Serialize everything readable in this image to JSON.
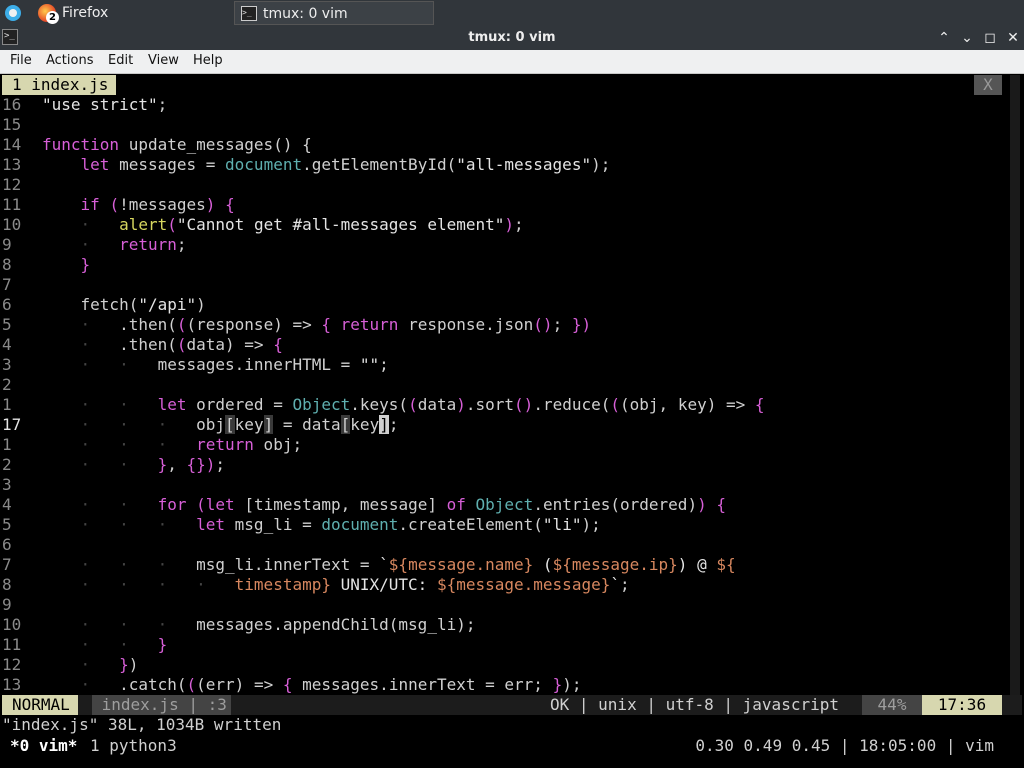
{
  "taskbar": {
    "tasks": [
      {
        "label": "Firefox",
        "badge": "2"
      },
      {
        "label": "tmux: 0 vim"
      }
    ]
  },
  "window": {
    "title": "tmux: 0 vim",
    "app_icon_glyph": ">_",
    "buttons": {
      "minimize": "⌃",
      "restore": "⌄",
      "maximize": "◻",
      "close": "✕"
    }
  },
  "menubar": [
    "File",
    "Actions",
    "Edit",
    "View",
    "Help"
  ],
  "vim": {
    "tab": {
      "number": "1",
      "name": "index.js",
      "close": "X"
    },
    "lines": [
      {
        "n": "16",
        "parts": [
          [
            "str",
            "\"use strict\""
          ],
          [
            "",
            ";"
          ]
        ]
      },
      {
        "n": "15",
        "parts": []
      },
      {
        "n": "14",
        "parts": [
          [
            "kw",
            "function"
          ],
          [
            "",
            " update_messages() {"
          ]
        ]
      },
      {
        "n": "13",
        "parts": [
          [
            "",
            "    "
          ],
          [
            "kw",
            "let"
          ],
          [
            "",
            " messages = "
          ],
          [
            "obj",
            "document"
          ],
          [
            "",
            ".getElementById("
          ],
          [
            "str",
            "\"all-messages\""
          ],
          [
            "",
            ");"
          ]
        ]
      },
      {
        "n": "12",
        "parts": []
      },
      {
        "n": "11",
        "parts": [
          [
            "",
            "    "
          ],
          [
            "kw",
            "if"
          ],
          [
            "",
            " "
          ],
          [
            "paren",
            "("
          ],
          [
            "",
            "!messages"
          ],
          [
            "paren",
            ")"
          ],
          [
            "",
            " "
          ],
          [
            "paren",
            "{"
          ]
        ]
      },
      {
        "n": "10",
        "parts": [
          [
            "dot",
            "    ·   "
          ],
          [
            "fn",
            "alert"
          ],
          [
            "paren",
            "("
          ],
          [
            "str",
            "\"Cannot get #all-messages element\""
          ],
          [
            "paren",
            ")"
          ],
          [
            "",
            ";"
          ]
        ]
      },
      {
        "n": "9",
        "parts": [
          [
            "dot",
            "    ·   "
          ],
          [
            "kw",
            "return"
          ],
          [
            "",
            ";"
          ]
        ]
      },
      {
        "n": "8",
        "parts": [
          [
            "",
            "    "
          ],
          [
            "paren",
            "}"
          ]
        ]
      },
      {
        "n": "7",
        "parts": []
      },
      {
        "n": "6",
        "parts": [
          [
            "",
            "    fetch("
          ],
          [
            "str",
            "\"/api\""
          ],
          [
            "",
            ")"
          ]
        ]
      },
      {
        "n": "5",
        "parts": [
          [
            "dot",
            "    ·   "
          ],
          [
            "",
            ".then("
          ],
          [
            "paren",
            "("
          ],
          [
            "",
            "(response) => "
          ],
          [
            "paren",
            "{"
          ],
          [
            "",
            " "
          ],
          [
            "kw",
            "return"
          ],
          [
            "",
            " response.json"
          ],
          [
            "paren",
            "()"
          ],
          [
            "",
            "; "
          ],
          [
            "paren",
            "}"
          ],
          [
            "paren",
            ")"
          ]
        ]
      },
      {
        "n": "4",
        "parts": [
          [
            "dot",
            "    ·   "
          ],
          [
            "",
            ".then("
          ],
          [
            "paren",
            "("
          ],
          [
            "",
            "data) => "
          ],
          [
            "paren",
            "{"
          ]
        ]
      },
      {
        "n": "3",
        "parts": [
          [
            "dot",
            "    ·   ·   "
          ],
          [
            "",
            "messages.innerHTML = "
          ],
          [
            "str",
            "\"\""
          ],
          [
            "",
            ";"
          ]
        ]
      },
      {
        "n": "2",
        "parts": []
      },
      {
        "n": "1",
        "parts": [
          [
            "dot",
            "    ·   ·   "
          ],
          [
            "kw",
            "let"
          ],
          [
            "",
            " ordered = "
          ],
          [
            "obj",
            "Object"
          ],
          [
            "",
            ".keys("
          ],
          [
            "paren",
            "("
          ],
          [
            "",
            "data"
          ],
          [
            "paren",
            ")"
          ],
          [
            "",
            ".sort"
          ],
          [
            "paren",
            "()"
          ],
          [
            "",
            ".reduce("
          ],
          [
            "paren",
            "("
          ],
          [
            "",
            "(obj, key) => "
          ],
          [
            "paren",
            "{"
          ]
        ]
      },
      {
        "n": "17",
        "current": true,
        "parts": [
          [
            "dot",
            "    ·   ·   ·   "
          ],
          [
            "",
            "obj"
          ],
          [
            "match",
            "["
          ],
          [
            "",
            "key"
          ],
          [
            "match",
            "]"
          ],
          [
            "",
            " = data"
          ],
          [
            "match",
            "["
          ],
          [
            "",
            "key"
          ],
          [
            "cursor",
            "]"
          ],
          [
            "",
            ";"
          ]
        ]
      },
      {
        "n": "1",
        "parts": [
          [
            "dot",
            "    ·   ·   ·   "
          ],
          [
            "kw",
            "return"
          ],
          [
            "",
            " obj;"
          ]
        ]
      },
      {
        "n": "2",
        "parts": [
          [
            "dot",
            "    ·   ·   "
          ],
          [
            "paren",
            "}"
          ],
          [
            "",
            ", "
          ],
          [
            "paren",
            "{}"
          ],
          [
            "paren",
            ")"
          ],
          [
            "",
            ";"
          ]
        ]
      },
      {
        "n": "3",
        "parts": []
      },
      {
        "n": "4",
        "parts": [
          [
            "dot",
            "    ·   ·   "
          ],
          [
            "kw",
            "for"
          ],
          [
            "",
            " "
          ],
          [
            "paren",
            "("
          ],
          [
            "kw",
            "let"
          ],
          [
            "",
            " [timestamp, message] "
          ],
          [
            "kw",
            "of"
          ],
          [
            "",
            " "
          ],
          [
            "obj",
            "Object"
          ],
          [
            "",
            ".entries(ordered)"
          ],
          [
            "paren",
            ")"
          ],
          [
            "",
            " "
          ],
          [
            "paren",
            "{"
          ]
        ]
      },
      {
        "n": "5",
        "parts": [
          [
            "dot",
            "    ·   ·   ·   "
          ],
          [
            "kw",
            "let"
          ],
          [
            "",
            " msg_li = "
          ],
          [
            "obj",
            "document"
          ],
          [
            "",
            ".createElement("
          ],
          [
            "str",
            "\"li\""
          ],
          [
            "",
            ");"
          ]
        ]
      },
      {
        "n": "6",
        "parts": []
      },
      {
        "n": "7",
        "parts": [
          [
            "dot",
            "    ·   ·   ·   "
          ],
          [
            "",
            "msg_li.innerText = "
          ],
          [
            "str",
            "`"
          ],
          [
            "tmpl",
            "${message.name}"
          ],
          [
            "str",
            " ("
          ],
          [
            "tmpl",
            "${message.ip}"
          ],
          [
            "str",
            ") @ "
          ],
          [
            "tmpl",
            "${"
          ]
        ]
      },
      {
        "n": "8",
        "parts": [
          [
            "dot",
            "    ·   ·   ·   ·   "
          ],
          [
            "tmpl",
            "timestamp}"
          ],
          [
            "str",
            " UNIX/UTC: "
          ],
          [
            "tmpl",
            "${message.message}"
          ],
          [
            "str",
            "`"
          ],
          [
            "",
            ";"
          ]
        ]
      },
      {
        "n": "9",
        "parts": []
      },
      {
        "n": "10",
        "parts": [
          [
            "dot",
            "    ·   ·   ·   "
          ],
          [
            "",
            "messages.appendChild(msg_li);"
          ]
        ]
      },
      {
        "n": "11",
        "parts": [
          [
            "dot",
            "    ·   ·   "
          ],
          [
            "paren",
            "}"
          ]
        ]
      },
      {
        "n": "12",
        "parts": [
          [
            "dot",
            "    ·   "
          ],
          [
            "paren",
            "}"
          ],
          [
            "",
            ")"
          ]
        ]
      },
      {
        "n": "13",
        "parts": [
          [
            "dot",
            "    ·   "
          ],
          [
            "",
            ".catch("
          ],
          [
            "paren",
            "("
          ],
          [
            "",
            "(err) => "
          ],
          [
            "paren",
            "{"
          ],
          [
            "",
            " messages.innerText = err; "
          ],
          [
            "paren",
            "}"
          ],
          [
            "",
            ");"
          ]
        ]
      }
    ],
    "status": {
      "mode": "NORMAL",
      "file": " index.js | :3",
      "right": "OK | unix | utf-8 | javascript",
      "percent": "44%",
      "position": "17:36"
    },
    "message": "\"index.js\" 38L, 1034B written"
  },
  "tmux": {
    "window0": "*0 vim*",
    "window1": "1 python3",
    "right": "0.30 0.49 0.45 | 18:05:00 | vim"
  }
}
